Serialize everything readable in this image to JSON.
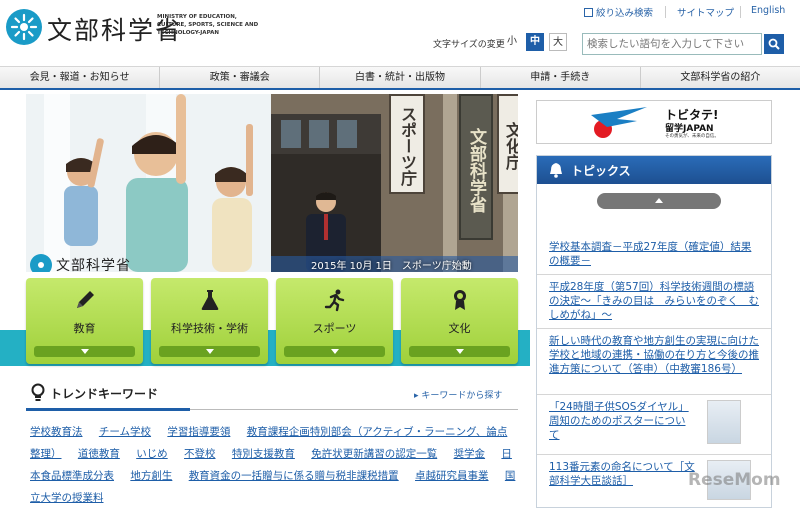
{
  "header": {
    "logo_name": "文部科学省",
    "logo_en": "MINISTRY OF EDUCATION, CULTURE, SPORTS, SCIENCE AND TECHNOLOGY-JAPAN",
    "utility_links": [
      "絞り込み検索",
      "サイトマップ",
      "English"
    ],
    "font_size_label": "文字サイズの変更",
    "font_size_options": [
      "小",
      "中",
      "大"
    ],
    "font_size_selected": "中",
    "search_placeholder": "検索したい語句を入力して下さい"
  },
  "global_nav": [
    "会見・報道・お知らせ",
    "政策・審議会",
    "白書・統計・出版物",
    "申請・手続き",
    "文部科学省の紹介"
  ],
  "hero": {
    "logo_text": "文部科学省",
    "caption": "2015年 10月 1日　スポーツ庁始動",
    "signs": [
      "スポーツ庁",
      "文部科学省",
      "文化庁"
    ]
  },
  "categories": [
    {
      "label": "教育",
      "icon": "pencil-icon"
    },
    {
      "label": "科学技術・学術",
      "icon": "flask-icon"
    },
    {
      "label": "スポーツ",
      "icon": "runner-icon"
    },
    {
      "label": "文化",
      "icon": "medal-icon"
    }
  ],
  "trend": {
    "title": "トレンドキーワード",
    "link": "キーワードから探す",
    "keywords": [
      "学校教育法",
      "チーム学校",
      "学習指導要領",
      "教育課程企画特別部会（アクティブ・ラーニング、論点整理）",
      "道徳教育",
      "いじめ",
      "不登校",
      "特別支援教育",
      "免許状更新講習の認定一覧",
      "奨学金",
      "日本食品標準成分表",
      "地方創生",
      "教育資金の一括贈与に係る贈与税非課税措置",
      "卓越研究員事業",
      "国立大学の授業料"
    ]
  },
  "banner": {
    "title": "トビタテ!",
    "subtitle": "留学JAPAN",
    "tagline": "その勇気が、未来の自信。"
  },
  "topics": {
    "title": "トピックス",
    "items": [
      "学校基本調査－平成27年度（確定値）結果の概要－",
      "平成28年度（第57回）科学技術週間の標語の決定～「きみの目は　みらいをのぞく　むしめがね」～",
      "新しい時代の教育や地方創生の実現に向けた学校と地域の連携・協働の在り方と今後の推進方策について（答申）（中教審186号）",
      "「24時間子供SOSダイヤル」周知のためのポスターについて",
      "113番元素の命名について［文部科学大臣談話］"
    ]
  },
  "watermark": "ReseMom",
  "colors": {
    "primary": "#1e5ea8",
    "teal": "#24b0c4",
    "category_green": "#a6d63c"
  }
}
